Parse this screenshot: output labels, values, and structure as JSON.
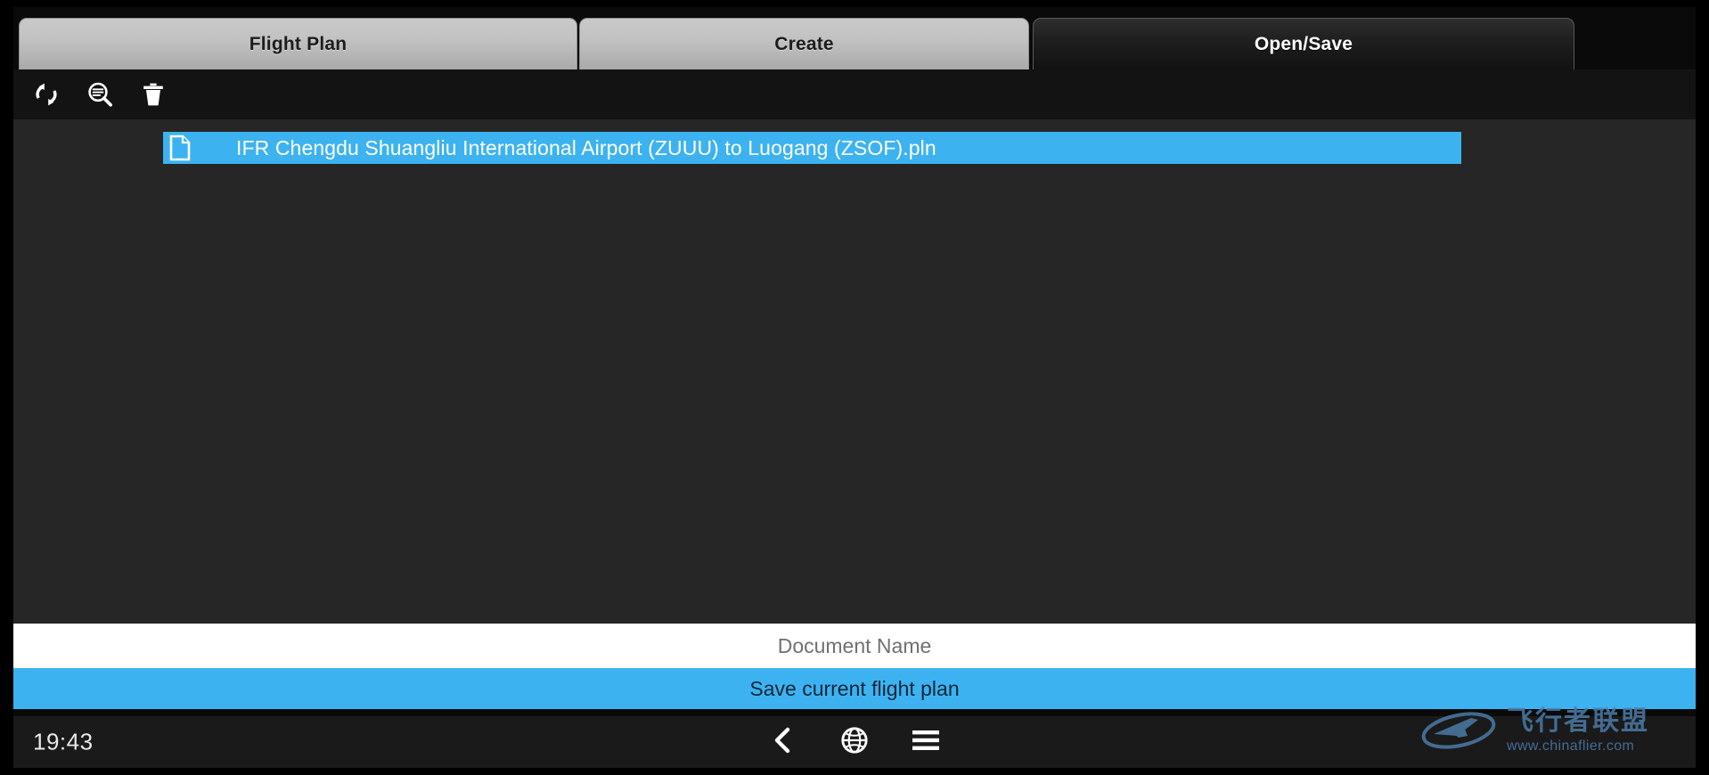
{
  "window": {
    "title": "Flight Plan Open/Save"
  },
  "tabs": [
    {
      "id": "flight-plan",
      "label": "Flight Plan",
      "active": false
    },
    {
      "id": "create",
      "label": "Create",
      "active": false
    },
    {
      "id": "open-save",
      "label": "Open/Save",
      "active": true
    }
  ],
  "toolbar": {
    "refresh_icon": "refresh-icon",
    "search_icon": "search-document-icon",
    "delete_icon": "trash-icon"
  },
  "file_list": {
    "items": [
      {
        "icon": "file-icon",
        "name": "IFR Chengdu Shuangliu International Airport (ZUUU) to Luogang (ZSOF).pln",
        "selected": true
      }
    ]
  },
  "document_name": {
    "value": "",
    "placeholder": "Document Name"
  },
  "save": {
    "label": "Save current flight plan"
  },
  "bottom_bar": {
    "clock": "19:43",
    "icons": [
      {
        "name": "back-icon",
        "glyph": "chevron-left"
      },
      {
        "name": "globe-icon",
        "glyph": "globe"
      },
      {
        "name": "menu-icon",
        "glyph": "hamburger"
      }
    ]
  },
  "watermark": {
    "brand_cn": "飞行者联盟",
    "url": "www.chinaflier.com"
  },
  "colors": {
    "accent_blue": "#3cb3f0",
    "panel_dark": "#262626",
    "toolbar_dark": "#131313",
    "tab_inactive": "#c2c2c2",
    "tab_active": "#1e1e1e",
    "watermark_blue": "#4d7fad"
  }
}
